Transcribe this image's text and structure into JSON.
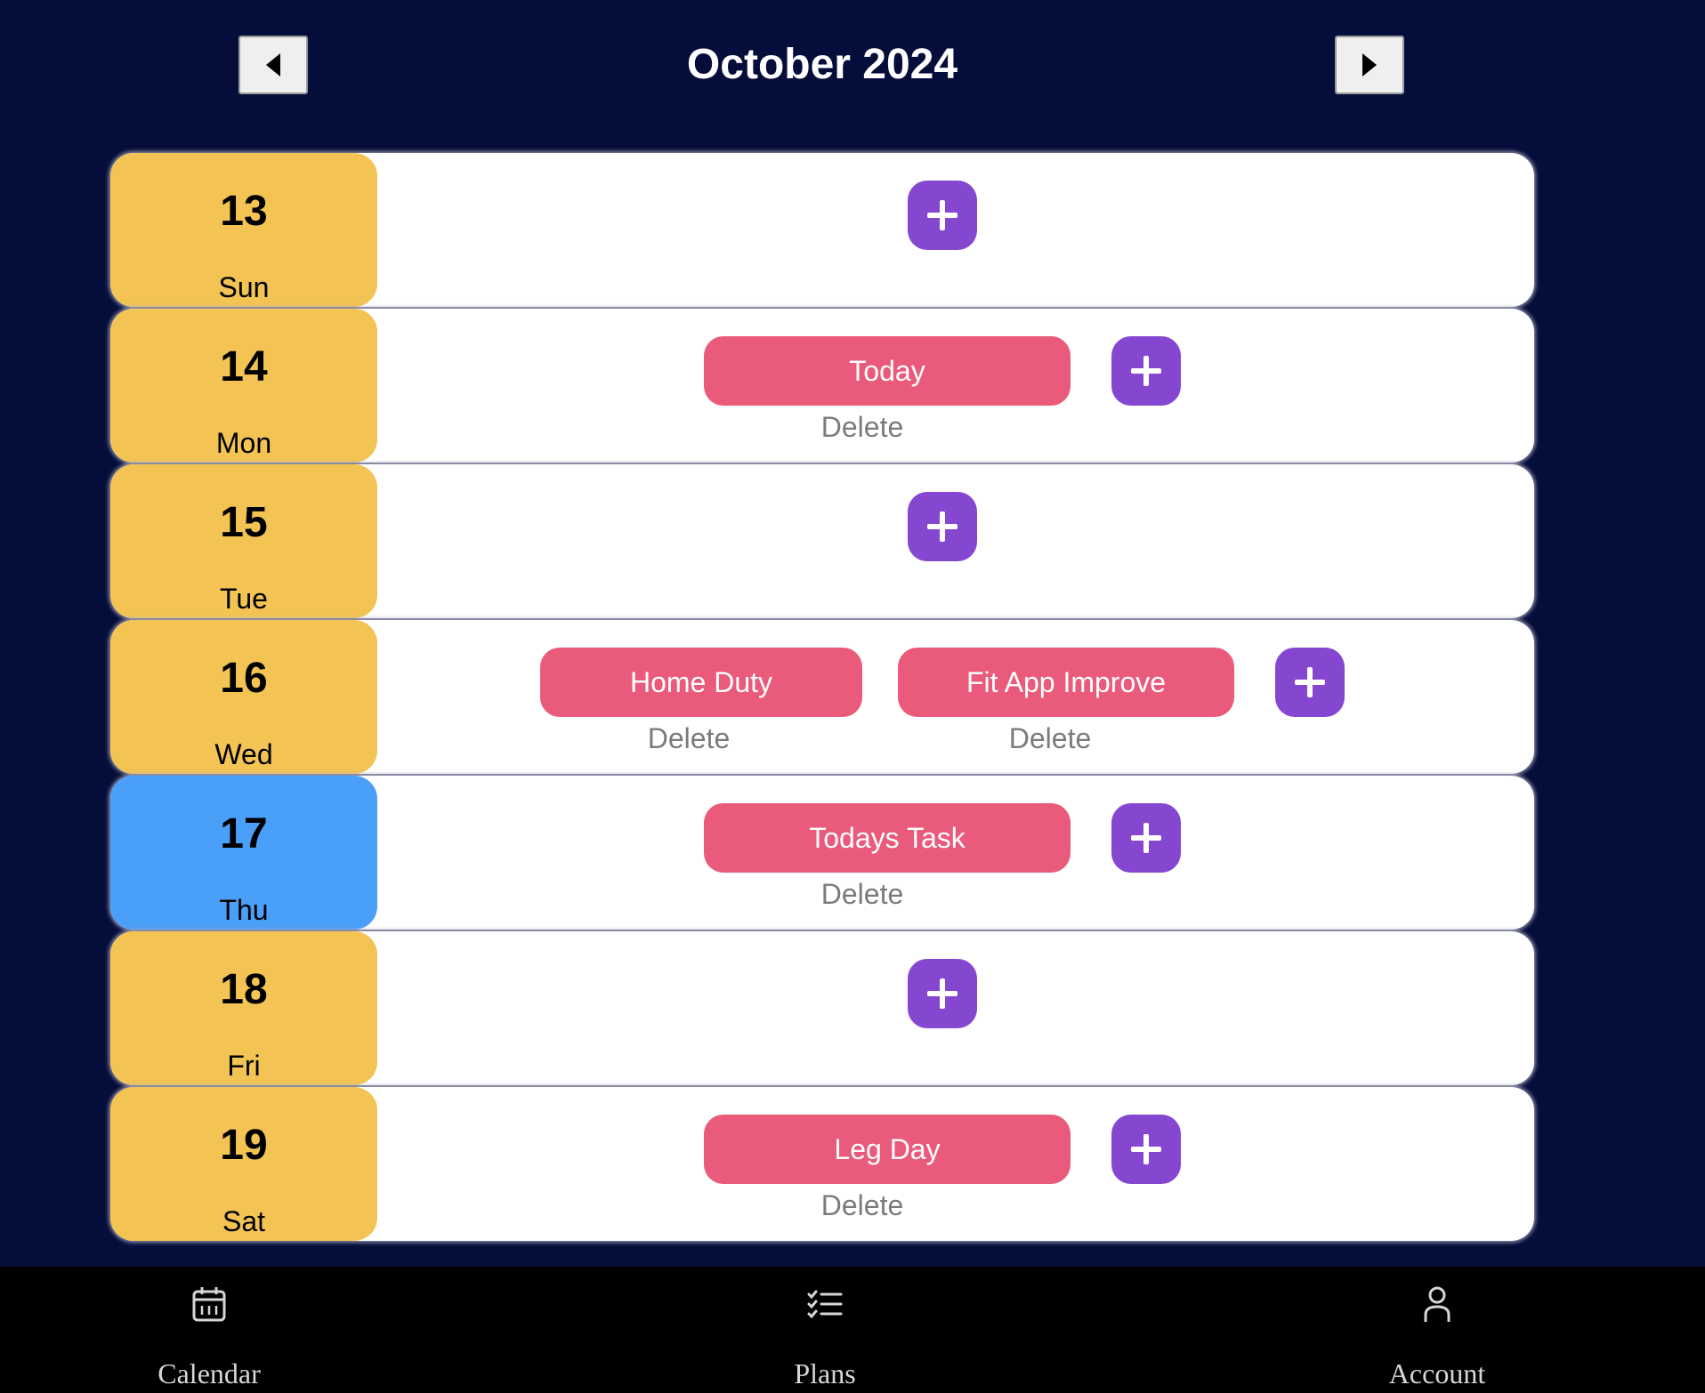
{
  "header": {
    "title": "October 2024",
    "prev_icon": "caret-left-icon",
    "next_icon": "caret-right-icon"
  },
  "days": [
    {
      "date": "13",
      "weekday": "Sun",
      "today": false,
      "plans": []
    },
    {
      "date": "14",
      "weekday": "Mon",
      "today": false,
      "plans": [
        {
          "name": "Today",
          "delete": "Delete"
        }
      ]
    },
    {
      "date": "15",
      "weekday": "Tue",
      "today": false,
      "plans": []
    },
    {
      "date": "16",
      "weekday": "Wed",
      "today": false,
      "plans": [
        {
          "name": "Home Duty",
          "delete": "Delete"
        },
        {
          "name": "Fit App Improve",
          "delete": "Delete"
        }
      ]
    },
    {
      "date": "17",
      "weekday": "Thu",
      "today": true,
      "plans": [
        {
          "name": "Todays Task",
          "delete": "Delete"
        }
      ]
    },
    {
      "date": "18",
      "weekday": "Fri",
      "today": false,
      "plans": []
    },
    {
      "date": "19",
      "weekday": "Sat",
      "today": false,
      "plans": [
        {
          "name": "Leg Day",
          "delete": "Delete"
        }
      ]
    }
  ],
  "add_icon": "plus-icon",
  "tabs": [
    {
      "label": "Calendar",
      "icon": "calendar-icon"
    },
    {
      "label": "Plans",
      "icon": "checklist-icon"
    },
    {
      "label": "Account",
      "icon": "user-icon"
    }
  ],
  "colors": {
    "background": "#050d3a",
    "date_box": "#f3c453",
    "date_box_today": "#4a9ff8",
    "plan_pill": "#ea5a7a",
    "add_button": "#8547d0",
    "tab_bar": "#000000"
  }
}
